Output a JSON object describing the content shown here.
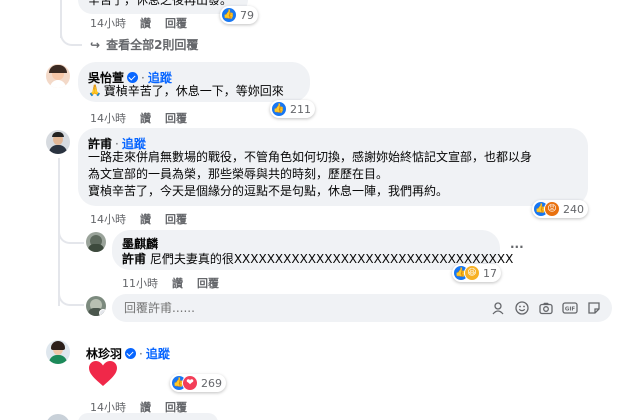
{
  "comment0": {
    "text_fragment": "辛苦了，休息之後再出發。",
    "reactions": "79",
    "time": "14小時",
    "reply": "讚",
    "respond": "回覆"
  },
  "view_more_replies": "查看全部2則回覆",
  "comment1": {
    "author": "吳怡萱",
    "follow": "追蹤",
    "text": "寶楨辛苦了，休息一下，等妳回來",
    "reactions": "211"
  },
  "comment2": {
    "author": "許甫",
    "follow": "追蹤",
    "lines": [
      "一路走來併肩無數場的戰役，不管角色如何切換，感謝妳始終惦記文宣部，也都以身",
      "為文宣部的一員為榮，那些榮辱與共的時刻，歷歷在目。",
      "寶楨辛苦了，今天是個緣分的逗點不是句點，休息一陣，我們再約。"
    ],
    "reactions": "240"
  },
  "reply1": {
    "author": "墨麒麟",
    "mention": "許甫",
    "text": " 尼們夫妻真的很XXXXXXXXXXXXXXXXXXXXXXXXXXXXXXXXXX",
    "more": "···",
    "reactions": "17",
    "time": "11小時",
    "like": "讚",
    "respond": "回覆"
  },
  "reply_input": {
    "placeholder": "回覆許甫......"
  },
  "comment3": {
    "author": "林珍羽",
    "follow": "追蹤",
    "reactions": "269",
    "time": "14小時",
    "like": "讚",
    "respond": "回覆"
  },
  "comment1_meta": {
    "time": "14小時",
    "like": "讚",
    "respond": "回覆"
  },
  "comment2_meta": {
    "time": "14小時",
    "like": "讚",
    "respond": "回覆"
  },
  "colors": {
    "accent": "#0866ff",
    "bubble": "#f0f2f5",
    "muted": "#65676b"
  }
}
